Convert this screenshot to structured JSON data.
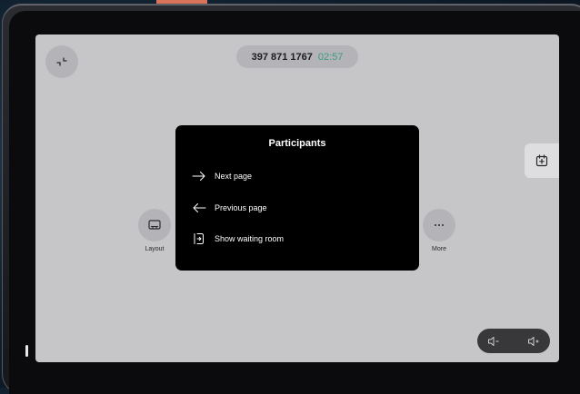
{
  "call": {
    "number": "397 871 1767",
    "duration": "02:57"
  },
  "controls": {
    "layout_label": "Layout",
    "more_label": "More",
    "minimize_icon": "minimize-icon",
    "share_icon": "share-screen-icon"
  },
  "participants_panel": {
    "title": "Participants",
    "items": [
      {
        "label": "Next page",
        "icon": "arrow-right-icon"
      },
      {
        "label": "Previous page",
        "icon": "arrow-left-icon"
      },
      {
        "label": "Show waiting room",
        "icon": "waiting-room-icon"
      }
    ]
  },
  "volume": {
    "down_icon": "volume-down-icon",
    "up_icon": "volume-up-icon"
  },
  "colors": {
    "timer": "#3e9a7c",
    "accent": "#d9735a",
    "panel_bg": "#000000",
    "screen_bg": "#c6c6c9"
  }
}
